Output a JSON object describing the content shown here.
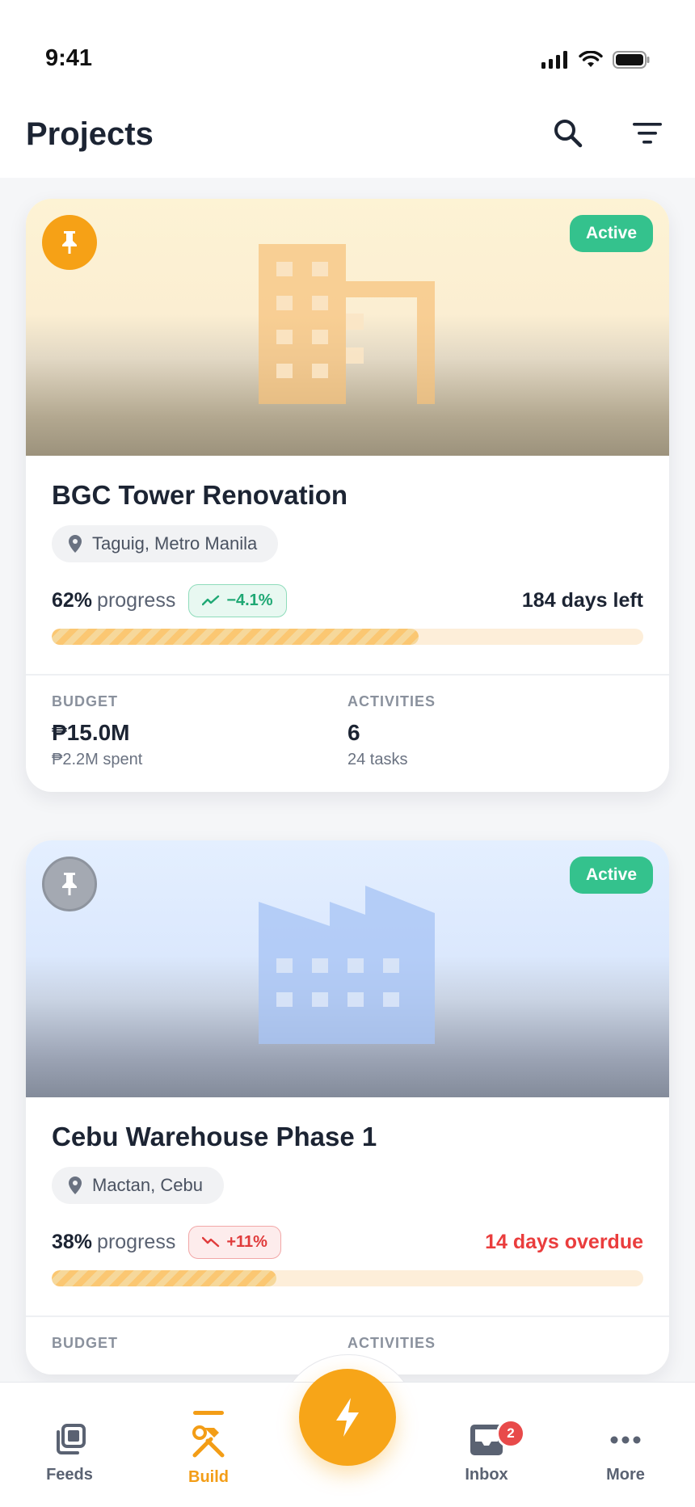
{
  "status_bar": {
    "time": "9:41"
  },
  "header": {
    "title": "Projects",
    "search_icon": "search-icon",
    "filter_icon": "filter-icon"
  },
  "colors": {
    "accent": "#f6a116",
    "active_badge": "#34c28d",
    "overdue": "#ea3d3d",
    "trend_up": "#1fa874",
    "trend_down": "#e03b3b"
  },
  "projects": [
    {
      "title": "BGC Tower Renovation",
      "status": "Active",
      "pinned": true,
      "location": "Taguig, Metro Manila",
      "progress_pct": "62%",
      "progress_label": "progress",
      "progress_value": 0.62,
      "trend": "−4.1%",
      "days": "184 days left",
      "budget_label": "BUDGET",
      "budget_value": "₱15.0M",
      "budget_sub": "₱2.2M spent",
      "activities_label": "ACTIVITIES",
      "activities_value": "6",
      "activities_sub": "24 tasks"
    },
    {
      "title": "Cebu Warehouse Phase 1",
      "status": "Active",
      "pinned": false,
      "location": "Mactan, Cebu",
      "progress_pct": "38%",
      "progress_label": "progress",
      "progress_value": 0.38,
      "trend": "+11%",
      "days": "14 days overdue",
      "budget_label": "BUDGET",
      "activities_label": "ACTIVITIES"
    }
  ],
  "nav": {
    "items": [
      {
        "label": "Feeds",
        "icon": "feeds-icon"
      },
      {
        "label": "Build",
        "icon": "build-icon",
        "active": true
      },
      {
        "label": "Inbox",
        "icon": "inbox-icon",
        "badge": "2"
      },
      {
        "label": "More",
        "icon": "more-icon"
      }
    ],
    "fab_icon": "lightning-icon"
  }
}
